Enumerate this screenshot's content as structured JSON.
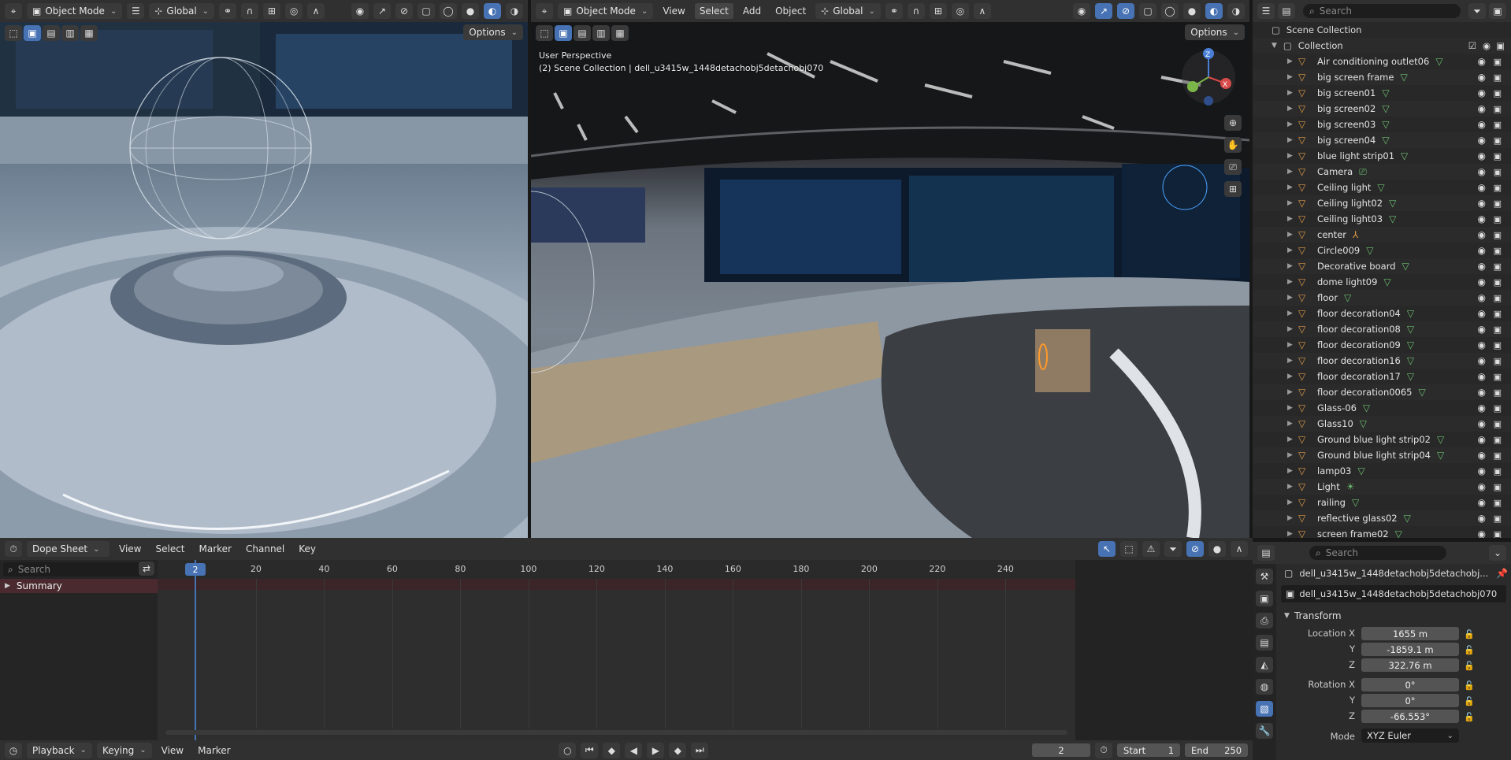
{
  "left_viewport": {
    "mode": "Object Mode",
    "orientation": "Global",
    "options": "Options"
  },
  "right_viewport": {
    "mode": "Object Mode",
    "menus": [
      "View",
      "Select",
      "Add",
      "Object"
    ],
    "orientation": "Global",
    "options": "Options",
    "overlay_view": "User Perspective",
    "overlay_object": "(2) Scene Collection | dell_u3415w_1448detachobj5detachobj070"
  },
  "outliner": {
    "search_placeholder": "Search",
    "scene_collection": "Scene Collection",
    "collection": "Collection",
    "items": [
      {
        "name": "Air conditioning outlet06",
        "type": "mesh"
      },
      {
        "name": "big screen frame",
        "type": "mesh"
      },
      {
        "name": "big screen01",
        "type": "mesh"
      },
      {
        "name": "big screen02",
        "type": "mesh"
      },
      {
        "name": "big screen03",
        "type": "mesh"
      },
      {
        "name": "big screen04",
        "type": "mesh"
      },
      {
        "name": "blue light strip01",
        "type": "mesh"
      },
      {
        "name": "Camera",
        "type": "camera"
      },
      {
        "name": "Ceiling light",
        "type": "mesh"
      },
      {
        "name": "Ceiling light02",
        "type": "mesh"
      },
      {
        "name": "Ceiling light03",
        "type": "mesh"
      },
      {
        "name": "center",
        "type": "empty"
      },
      {
        "name": "Circle009",
        "type": "mesh"
      },
      {
        "name": "Decorative board",
        "type": "mesh"
      },
      {
        "name": "dome light09",
        "type": "mesh"
      },
      {
        "name": "floor",
        "type": "mesh"
      },
      {
        "name": "floor decoration04",
        "type": "mesh"
      },
      {
        "name": "floor decoration08",
        "type": "mesh"
      },
      {
        "name": "floor decoration09",
        "type": "mesh"
      },
      {
        "name": "floor decoration16",
        "type": "mesh"
      },
      {
        "name": "floor decoration17",
        "type": "mesh"
      },
      {
        "name": "floor decoration0065",
        "type": "mesh"
      },
      {
        "name": "Glass-06",
        "type": "mesh"
      },
      {
        "name": "Glass10",
        "type": "mesh"
      },
      {
        "name": "Ground blue light strip02",
        "type": "mesh"
      },
      {
        "name": "Ground blue light strip04",
        "type": "mesh"
      },
      {
        "name": "lamp03",
        "type": "mesh"
      },
      {
        "name": "Light",
        "type": "light"
      },
      {
        "name": "railing",
        "type": "mesh"
      },
      {
        "name": "reflective glass02",
        "type": "mesh"
      },
      {
        "name": "screen frame02",
        "type": "mesh"
      }
    ]
  },
  "dope_sheet": {
    "editor": "Dope Sheet",
    "menus": [
      "View",
      "Select",
      "Marker",
      "Channel",
      "Key"
    ],
    "search_placeholder": "Search",
    "summary": "Summary",
    "current_frame": "2",
    "frame_ticks": [
      "20",
      "40",
      "60",
      "80",
      "100",
      "120",
      "140",
      "160",
      "180",
      "200",
      "220",
      "240"
    ]
  },
  "timeline": {
    "menus": [
      "Playback",
      "Keying",
      "View",
      "Marker"
    ],
    "frame": "2",
    "start_label": "Start",
    "start": "1",
    "end_label": "End",
    "end": "250"
  },
  "properties": {
    "search_placeholder": "Search",
    "object_title": "dell_u3415w_1448detachobj5detachobj...",
    "object_name": "dell_u3415w_1448detachobj5detachobj070",
    "transform_label": "Transform",
    "location_x_label": "Location X",
    "location_x": "1655 m",
    "location_y": "-1859.1 m",
    "location_z": "322.76 m",
    "rotation_x_label": "Rotation X",
    "rotation_x": "0°",
    "rotation_y": "0°",
    "rotation_z": "-66.553°",
    "y_label": "Y",
    "z_label": "Z",
    "mode_label": "Mode",
    "mode": "XYZ Euler"
  },
  "colors": {
    "accent": "#4772b3",
    "panel": "#303030",
    "mesh_icon": "#6cc070",
    "object_icon": "#e09a4a",
    "playhead": "#4772b3",
    "summary_row": "#4a2a2e"
  }
}
